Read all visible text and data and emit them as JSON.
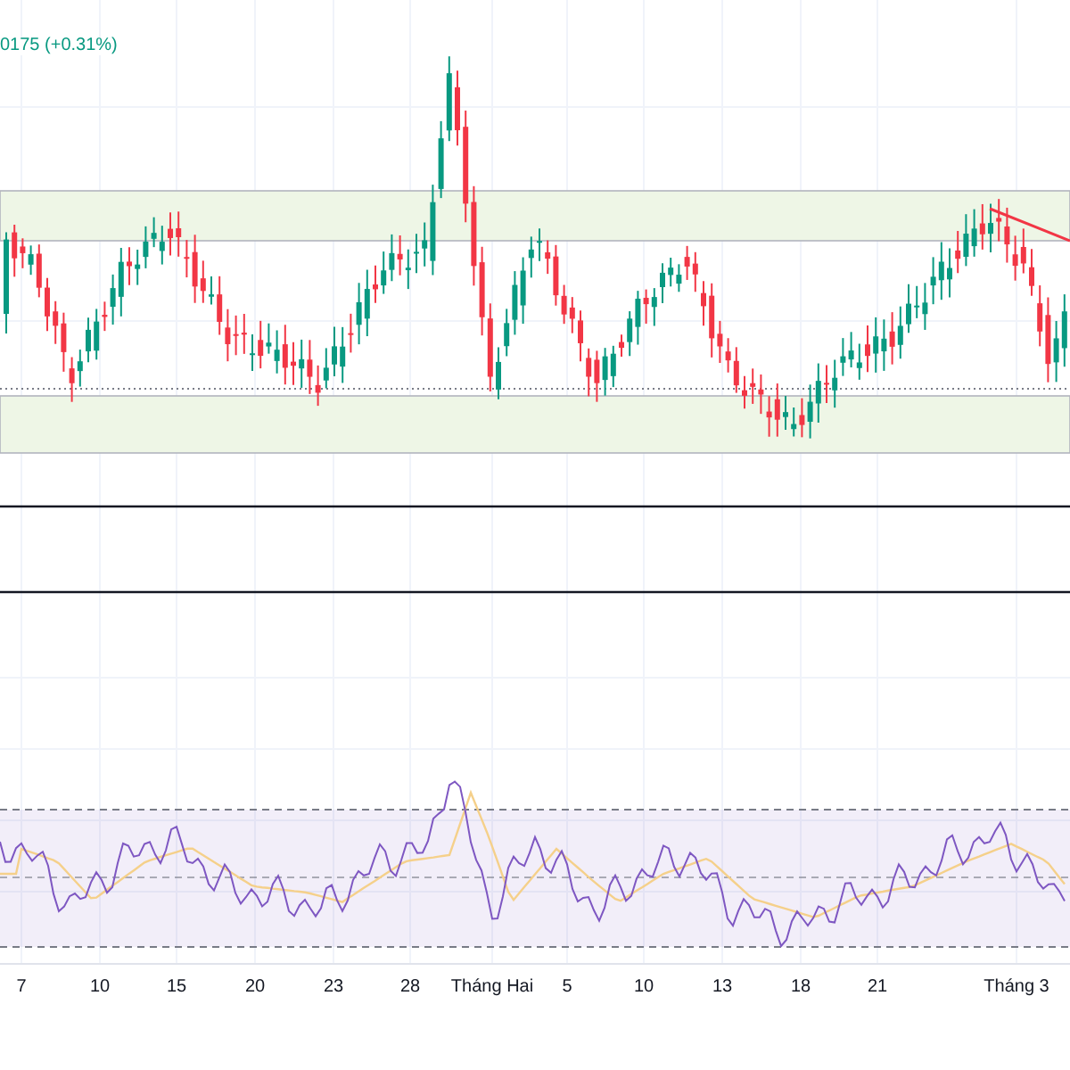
{
  "legend": {
    "change": "0175 (+0.31%)"
  },
  "x_axis": {
    "labels": [
      "7",
      "10",
      "15",
      "20",
      "23",
      "28",
      "Tháng Hai",
      "5",
      "10",
      "13",
      "18",
      "21",
      "Tháng 3"
    ]
  }
}
